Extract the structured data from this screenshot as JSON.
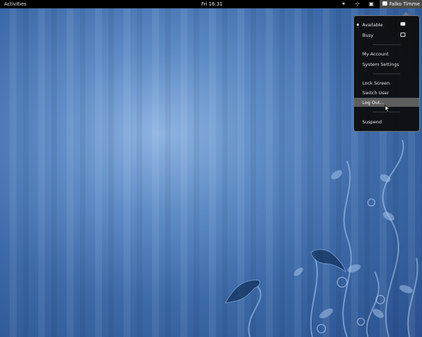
{
  "topbar": {
    "activities_label": "Activities",
    "clock": "Fri 16:31",
    "user_name": "Falko Timme",
    "tray_icons": [
      "accessibility-icon",
      "volume-icon",
      "network-icon"
    ]
  },
  "menu": {
    "status_items": [
      {
        "label": "Available",
        "selected": true,
        "icon": "chat-available-icon"
      },
      {
        "label": "Busy",
        "selected": false,
        "icon": "chat-busy-icon"
      }
    ],
    "account_items": [
      "My Account",
      "System Settings"
    ],
    "session_items": [
      "Lock Screen",
      "Switch User",
      "Log Out..."
    ],
    "highlighted": "Log Out...",
    "suspend_label": "Suspend"
  },
  "colors": {
    "panel": "#000000",
    "menu_bg": "#0c0c0c",
    "highlight": "#5e5e5e",
    "wallpaper": "#3c6aa6"
  }
}
